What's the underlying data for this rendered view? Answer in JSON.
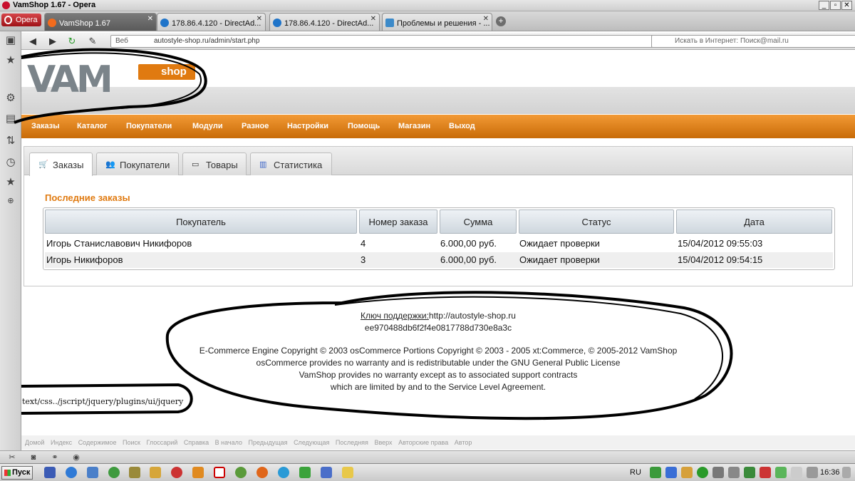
{
  "window": {
    "title": "VamShop 1.67 - Opera",
    "min_icon": "minimize-icon",
    "restore_icon": "restore-icon",
    "close_icon": "close-icon"
  },
  "browser": {
    "menu_label": "Opera",
    "tabs": [
      {
        "label": "VamShop 1.67"
      },
      {
        "label": "178.86.4.120 - DirectAd..."
      },
      {
        "label": "178.86.4.120 - DirectAd..."
      },
      {
        "label": "Проблемы и решения - ..."
      }
    ],
    "address_prefix": "Веб",
    "address": "autostyle-shop.ru/admin/start.php",
    "search_placeholder": "Искать в Интернет: Поиск@mail.ru"
  },
  "site": {
    "logo_text": "VAM",
    "logo_shop": "shop",
    "menu": [
      "Заказы",
      "Каталог",
      "Покупатели",
      "Модули",
      "Разное",
      "Настройки",
      "Помощь",
      "Магазин",
      "Выход"
    ],
    "tabs": [
      {
        "label": "Заказы",
        "icon": "cart-icon"
      },
      {
        "label": "Покупатели",
        "icon": "users-icon"
      },
      {
        "label": "Товары",
        "icon": "box-icon"
      },
      {
        "label": "Статистика",
        "icon": "chart-icon"
      }
    ],
    "section_title": "Последние заказы",
    "table": {
      "headers": [
        "Покупатель",
        "Номер заказа",
        "Сумма",
        "Статус",
        "Дата"
      ],
      "rows": [
        [
          "Игорь Станиславович Никифоров",
          "4",
          "6.000,00 руб.",
          "Ожидает проверки",
          "15/04/2012 09:55:03"
        ],
        [
          "Игорь Никифоров",
          "3",
          "6.000,00 руб.",
          "Ожидает проверки",
          "15/04/2012 09:54:15"
        ]
      ]
    },
    "footer": {
      "support_label": "Ключ поддержки:",
      "support_url": "http://autostyle-shop.ru",
      "support_key": "ee970488db6f2f4e0817788d730e8a3c",
      "line1": "E-Commerce Engine Copyright © 2003 osCommerce Portions Copyright © 2003 - 2005 xt:Commerce, © 2005-2012 VamShop",
      "line2": "osCommerce provides no warranty and is redistributable under the GNU General Public License",
      "line3": "VamShop provides no warranty except as to associated support contracts",
      "line4": "which are limited by and to the Service Level Agreement."
    },
    "status_text": "text/css../jscript/jquery/plugins/ui/jquery",
    "bottom_links": [
      "Домой",
      "Индекс",
      "Содержимое",
      "Поиск",
      "Глоссарий",
      "Справка",
      "В начало",
      "Предыдущая",
      "Следующая",
      "Последняя",
      "Вверх",
      "Авторские права",
      "Автор"
    ]
  },
  "taskbar": {
    "start_label": "Пуск",
    "lang": "RU",
    "time": "16:36"
  }
}
